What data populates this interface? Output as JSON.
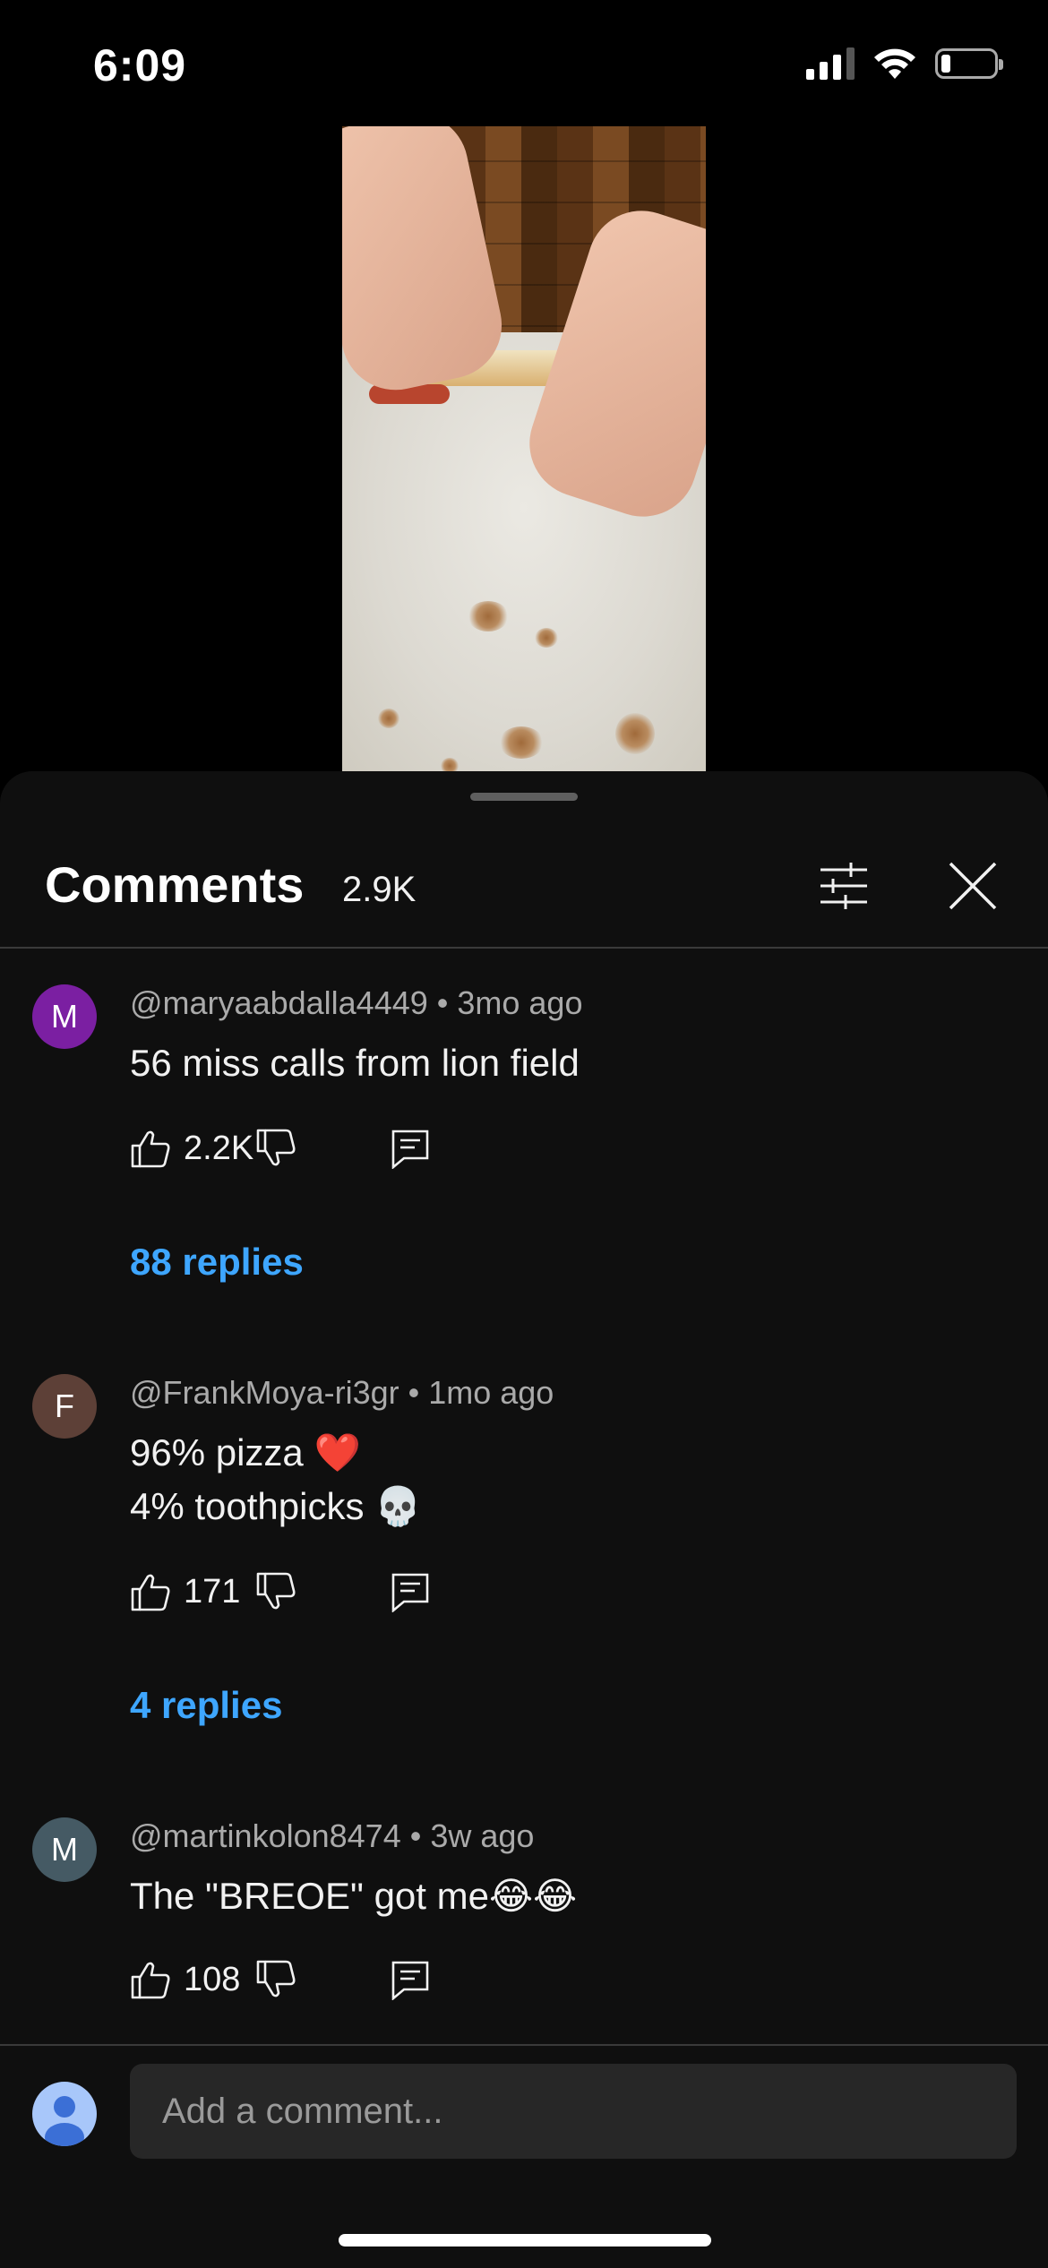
{
  "status_bar": {
    "time": "6:09",
    "battery_level": 0.18,
    "signal_bars": 3
  },
  "comments_panel": {
    "title": "Comments",
    "count": "2.9K"
  },
  "comments": [
    {
      "avatar_letter": "M",
      "avatar_color": "#7b1fa2",
      "author": "@maryaabdalla4449",
      "time": "3mo ago",
      "meta": "@maryaabdalla4449 • 3mo ago",
      "text_lines": [
        "56 miss calls from lion field"
      ],
      "likes": "2.2K",
      "replies": "88 replies"
    },
    {
      "avatar_letter": "F",
      "avatar_color": "#5d4037",
      "author": "@FrankMoya-ri3gr",
      "time": "1mo ago",
      "meta": "@FrankMoya-ri3gr • 1mo ago",
      "text_lines": [
        "96% pizza ❤️",
        "4% toothpicks 💀"
      ],
      "likes": "171",
      "replies": "4 replies"
    },
    {
      "avatar_letter": "M",
      "avatar_color": "#455a64",
      "author": "@martinkolon8474",
      "time": "3w ago",
      "meta": "@martinkolon8474 • 3w ago",
      "text_lines": [
        "The \"BREOE\" got me😂😂"
      ],
      "likes": "108",
      "replies": ""
    }
  ],
  "composer": {
    "placeholder": "Add a comment..."
  },
  "icons": {
    "like": "thumb-up-icon",
    "dislike": "thumb-down-icon",
    "reply": "comment-reply-icon",
    "filter": "sliders-icon",
    "close": "close-icon"
  },
  "colors": {
    "link": "#3ea6ff",
    "sheet_bg": "#0f0f0f",
    "input_bg": "#272727"
  }
}
